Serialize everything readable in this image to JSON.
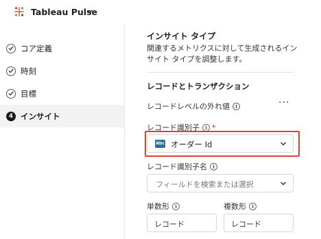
{
  "app": {
    "title": "Tableau Pulse"
  },
  "sidebar": {
    "items": [
      {
        "label": "コア定義",
        "status": "done"
      },
      {
        "label": "時刻",
        "status": "done"
      },
      {
        "label": "目標",
        "status": "done"
      },
      {
        "label": "インサイト",
        "status": "current",
        "step": "4"
      }
    ]
  },
  "main": {
    "section_title": "インサイト タイプ",
    "section_desc": "関連するメトリクスに対して生成されるインサイト タイプを調整します。",
    "subsection_title": "レコードとトランザクション",
    "outliers_label": "レコードレベルの外れ値",
    "more_label": "···",
    "record_id": {
      "label": "レコード識別子",
      "required_mark": "*",
      "type_badge": "Abc",
      "value": "オーダー Id"
    },
    "record_id_name": {
      "label": "レコード識別子名",
      "placeholder": "フィールドを検索または選択"
    },
    "singular": {
      "label": "単数形",
      "value": "レコード"
    },
    "plural": {
      "label": "複数形",
      "value": "レコード"
    }
  },
  "colors": {
    "highlight": "#e0402c",
    "badge": "#2f6e9c",
    "required": "#c8202b"
  },
  "info_glyph": "i"
}
